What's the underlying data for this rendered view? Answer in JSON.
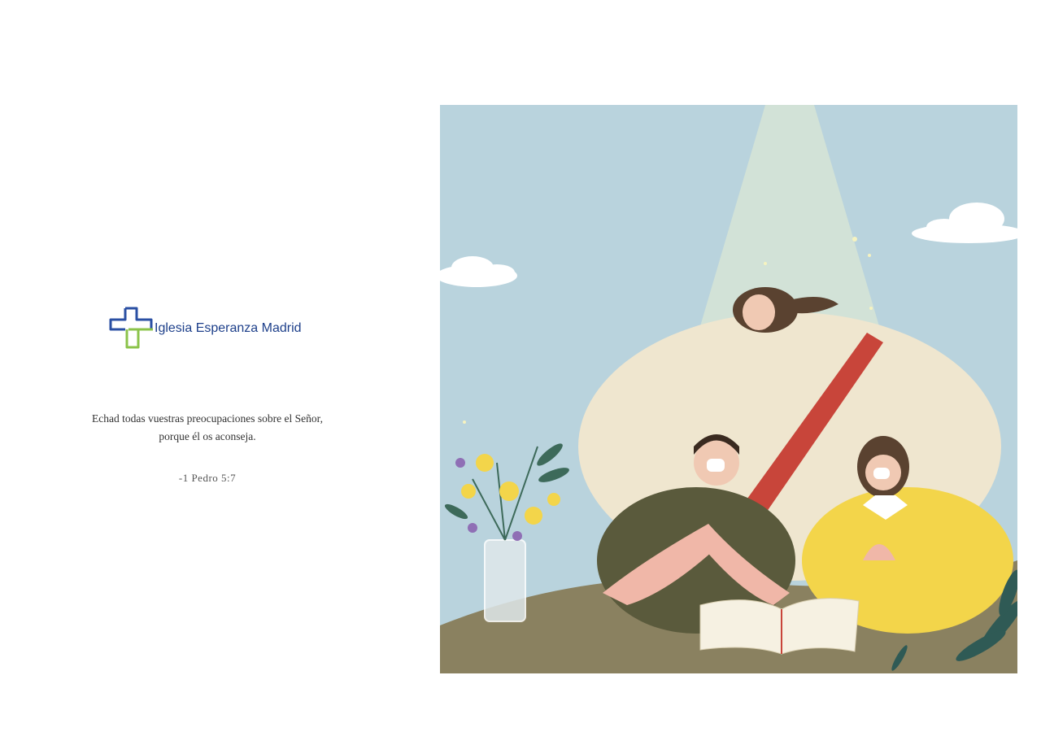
{
  "brand": {
    "name": "Iglesia Esperanza Madrid",
    "logo_colors": {
      "blue": "#2a4fa3",
      "green": "#8bc34a"
    }
  },
  "verse": {
    "line1": "Echad todas vuestras preocupaciones sobre el Señor,",
    "line2": "porque él os aconseja.",
    "reference": "-1 Pedro 5:7"
  },
  "illustration": {
    "icon": "praying-people-illustration",
    "colors": {
      "sky": "#b9d3dd",
      "ground": "#8a8160",
      "robe": "#efe6cf",
      "sash": "#c8453a",
      "shirt_green": "#5a5a3c",
      "shirt_yellow": "#f3d54a",
      "skin": "#f0b7a8"
    }
  }
}
